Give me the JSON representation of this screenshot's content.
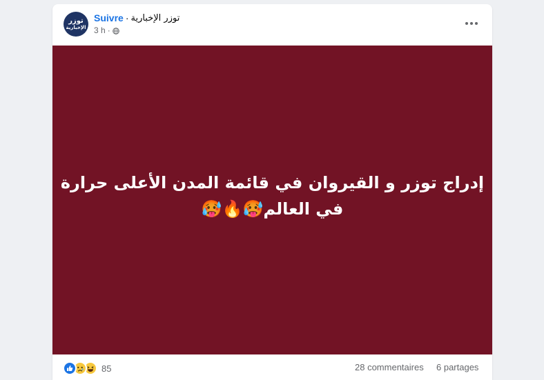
{
  "post": {
    "page_name": "توزر الإخبارية",
    "follow_label": "Suivre",
    "separator": "·",
    "avatar_line1": "توزر",
    "avatar_line2": "الإخبارية",
    "time": "3 h",
    "audience_icon": "globe-icon",
    "more_icon": "more-options-icon",
    "text_line1": "إدراج توزر و القيروان في قائمة المدن الأعلى حرارة",
    "text_line2": "في العالم🥵🔥🥵",
    "background_color": "#721325",
    "accent_color": "#1b74e4"
  },
  "footer": {
    "reaction_icons": [
      "like-icon",
      "sad-icon",
      "haha-icon"
    ],
    "reaction_count": "85",
    "comments": "28 commentaires",
    "shares": "6 partages"
  }
}
